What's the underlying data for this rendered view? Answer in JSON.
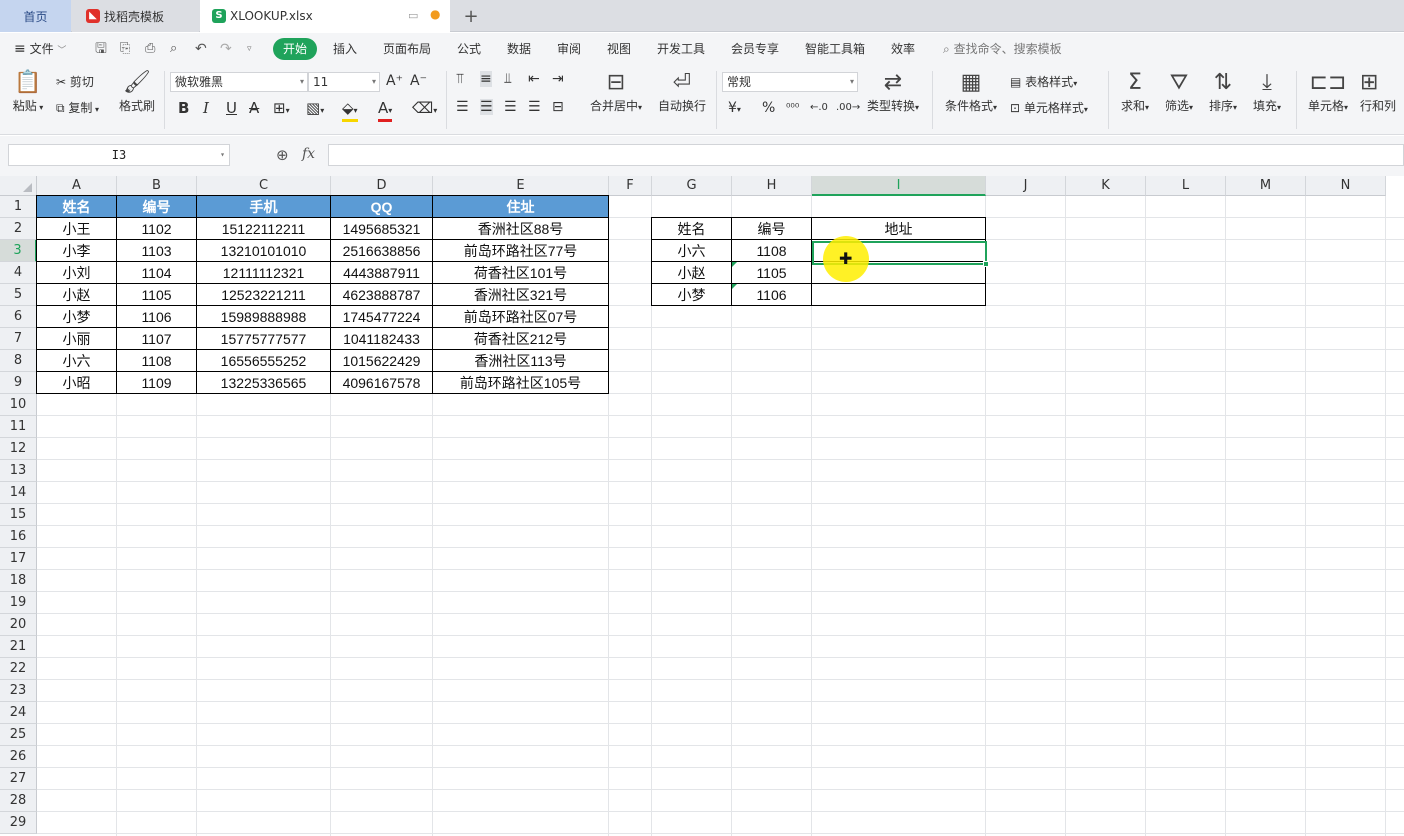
{
  "tabs": {
    "home": "首页",
    "daoke": "找稻壳模板",
    "file": "XLOOKUP.xlsx"
  },
  "menu": {
    "file": "文件",
    "items": [
      "开始",
      "插入",
      "页面布局",
      "公式",
      "数据",
      "审阅",
      "视图",
      "开发工具",
      "会员专享",
      "智能工具箱",
      "效率"
    ],
    "search": "查找命令、搜索模板"
  },
  "ribbon": {
    "paste": "粘贴",
    "cut": "剪切",
    "copy": "复制",
    "format_painter": "格式刷",
    "font_name": "微软雅黑",
    "font_size": "11",
    "merge_center": "合并居中",
    "wrap": "自动换行",
    "number_format": "常规",
    "type_convert": "类型转换",
    "cond_format": "条件格式",
    "table_style": "表格样式",
    "cell_style": "单元格样式",
    "sum": "求和",
    "filter": "筛选",
    "sort": "排序",
    "fill": "填充",
    "cell": "单元格",
    "row_col": "行和列"
  },
  "formula_bar": {
    "name_box": "I3",
    "fx": "fx",
    "content": ""
  },
  "columns": [
    "A",
    "B",
    "C",
    "D",
    "E",
    "F",
    "G",
    "H",
    "I",
    "J",
    "K",
    "L",
    "M",
    "N"
  ],
  "selected_column": "I",
  "rows": [
    1,
    2,
    3,
    4,
    5,
    6,
    7,
    8,
    9,
    10,
    11,
    12,
    13,
    14,
    15,
    16,
    17,
    18,
    19,
    20,
    21,
    22,
    23,
    24,
    25,
    26,
    27,
    28,
    29
  ],
  "selected_row": 3,
  "table1": {
    "headers": [
      "姓名",
      "编号",
      "手机",
      "QQ",
      "住址"
    ],
    "rows": [
      [
        "小王",
        "1102",
        "15122112211",
        "1495685321",
        "香洲社区88号"
      ],
      [
        "小李",
        "1103",
        "13210101010",
        "2516638856",
        "前岛环路社区77号"
      ],
      [
        "小刘",
        "1104",
        "12111112321",
        "4443887911",
        "荷香社区101号"
      ],
      [
        "小赵",
        "1105",
        "12523221211",
        "4623888787",
        "香洲社区321号"
      ],
      [
        "小梦",
        "1106",
        "15989888988",
        "1745477224",
        "前岛环路社区07号"
      ],
      [
        "小丽",
        "1107",
        "15775777577",
        "1041182433",
        "荷香社区212号"
      ],
      [
        "小六",
        "1108",
        "16556555252",
        "1015622429",
        "香洲社区113号"
      ],
      [
        "小昭",
        "1109",
        "13225336565",
        "4096167578",
        "前岛环路社区105号"
      ]
    ],
    "header_color": "#5b9bd5"
  },
  "table2": {
    "headers": [
      "姓名",
      "编号",
      "地址"
    ],
    "rows": [
      [
        "小六",
        "1108",
        ""
      ],
      [
        "小赵",
        "1105",
        ""
      ],
      [
        "小梦",
        "1106",
        ""
      ]
    ]
  },
  "accent_color": "#1fa35b"
}
